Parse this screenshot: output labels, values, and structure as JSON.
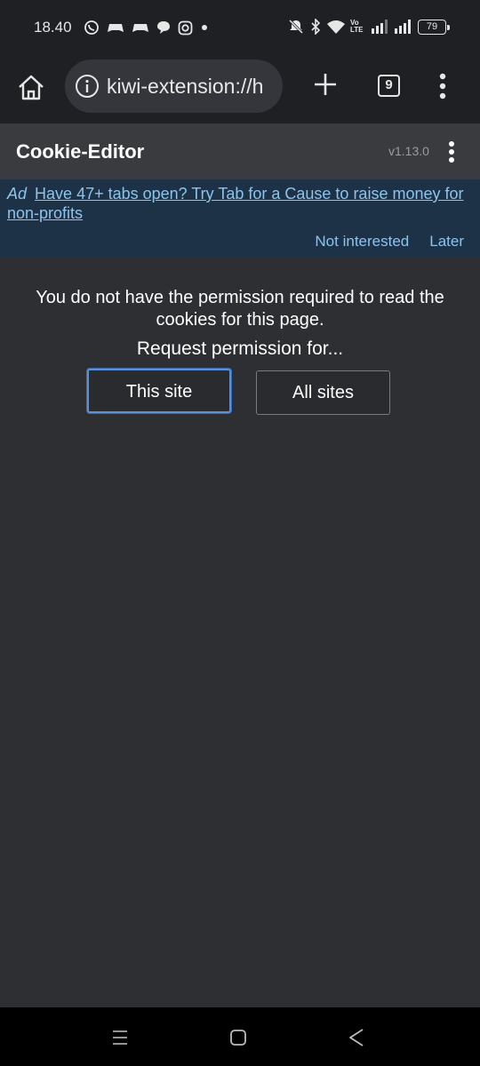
{
  "status_bar": {
    "time": "18.40",
    "battery": "79",
    "left_icons": [
      "whatsapp-icon",
      "game-controller-icon",
      "game-controller-icon",
      "chat-bubble-icon",
      "instagram-icon",
      "dot-icon"
    ],
    "right_icons": [
      "mute-icon",
      "bluetooth-icon",
      "wifi-icon",
      "volte-icon",
      "signal-icon",
      "signal-icon"
    ],
    "volte_text": "Vo LTE"
  },
  "browser": {
    "url": "kiwi-extension://h",
    "tab_count": "9"
  },
  "extension": {
    "title": "Cookie-Editor",
    "version": "v1.13.0"
  },
  "ad": {
    "label": "Ad",
    "text": "Have 47+ tabs open? Try Tab for a Cause to raise money for non-profits",
    "not_interested": "Not interested",
    "later": "Later"
  },
  "main": {
    "message": "You do not have the permission required to read the cookies for this page.",
    "request_label": "Request permission for...",
    "this_site_button": "This site",
    "all_sites_button": "All sites"
  },
  "colors": {
    "background": "#2e2f33",
    "toolbar": "#1f2023",
    "header": "#3a3b3f",
    "ad_background": "#1e3247",
    "link": "#8ec3ea",
    "focus_border": "#5b8fd6"
  }
}
